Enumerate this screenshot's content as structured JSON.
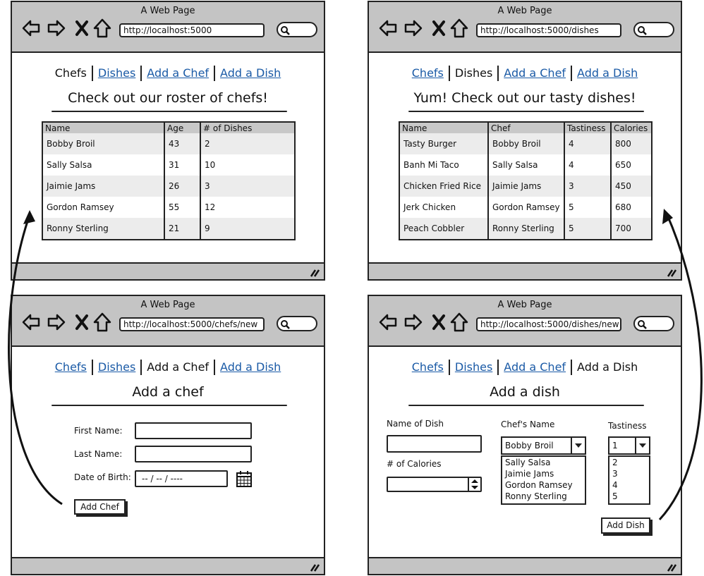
{
  "window_title": "A Web Page",
  "nav": {
    "chefs": "Chefs",
    "dishes": "Dishes",
    "add_chef": "Add a Chef",
    "add_dish": "Add a Dish"
  },
  "chefs_page": {
    "url": "http://localhost:5000",
    "heading": "Check out our roster of chefs!",
    "columns": [
      "Name",
      "Age",
      "# of Dishes"
    ],
    "rows": [
      [
        "Bobby Broil",
        "43",
        "2"
      ],
      [
        "Sally Salsa",
        "31",
        "10"
      ],
      [
        "Jaimie Jams",
        "26",
        "3"
      ],
      [
        "Gordon Ramsey",
        "55",
        "12"
      ],
      [
        "Ronny Sterling",
        "21",
        "9"
      ]
    ]
  },
  "dishes_page": {
    "url": "http://localhost:5000/dishes",
    "heading": "Yum! Check out our tasty dishes!",
    "columns": [
      "Name",
      "Chef",
      "Tastiness",
      "Calories"
    ],
    "rows": [
      [
        "Tasty Burger",
        "Bobby Broil",
        "4",
        "800"
      ],
      [
        "Banh Mi Taco",
        "Sally Salsa",
        "4",
        "650"
      ],
      [
        "Chicken Fried Rice",
        "Jaimie Jams",
        "3",
        "450"
      ],
      [
        "Jerk Chicken",
        "Gordon Ramsey",
        "5",
        "680"
      ],
      [
        "Peach Cobbler",
        "Ronny Sterling",
        "5",
        "700"
      ]
    ]
  },
  "new_chef_page": {
    "url": "http://localhost:5000/chefs/new",
    "heading": "Add a chef",
    "first_name_label": "First Name:",
    "last_name_label": "Last Name:",
    "dob_label": "Date of Birth:",
    "dob_placeholder": "-- / -- / ----",
    "submit": "Add Chef"
  },
  "new_dish_page": {
    "url": "http://localhost:5000/dishes/new",
    "heading": "Add a dish",
    "name_label": "Name of Dish",
    "calories_label": "# of Calories",
    "chef_label": "Chef's Name",
    "chef_selected": "Bobby Broil",
    "chef_options": [
      "Sally Salsa",
      "Jaimie Jams",
      "Gordon Ramsey",
      "Ronny Sterling"
    ],
    "tastiness_label": "Tastiness",
    "tastiness_selected": "1",
    "tastiness_options": [
      "2",
      "3",
      "4",
      "5"
    ],
    "submit": "Add Dish"
  }
}
